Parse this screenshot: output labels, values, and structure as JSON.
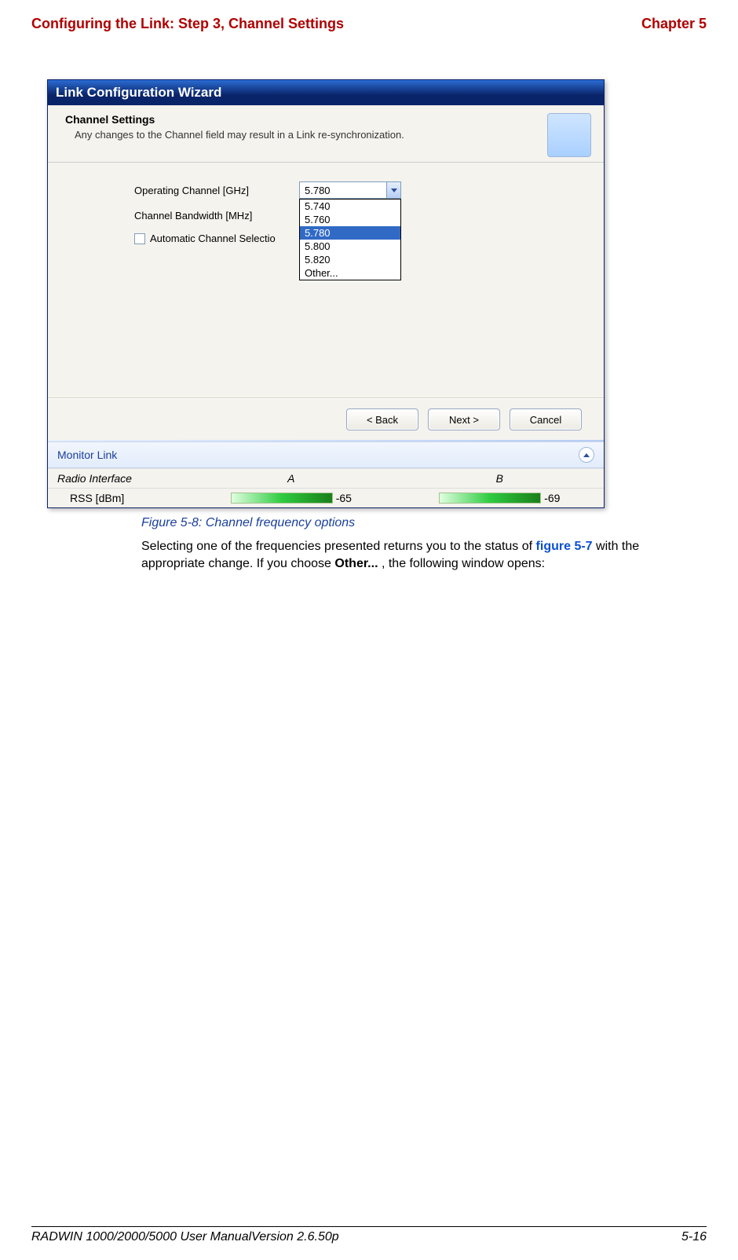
{
  "page": {
    "header_left": "Configuring the Link: Step 3, Channel Settings",
    "header_right": "Chapter 5",
    "footer_left": "RADWIN 1000/2000/5000 User ManualVersion  2.6.50p",
    "footer_right": "5-16"
  },
  "window": {
    "title": "Link Configuration Wizard",
    "heading": "Channel Settings",
    "subheading": "Any changes to the Channel field may result in a Link re-synchronization.",
    "labels": {
      "operating_channel": "Operating Channel [GHz]",
      "channel_bandwidth": "Channel Bandwidth [MHz]",
      "auto_channel": "Automatic Channel Selectio"
    },
    "operating_channel_value": "5.780",
    "dropdown_options": [
      "5.740",
      "5.760",
      "5.780",
      "5.800",
      "5.820",
      "Other..."
    ],
    "dropdown_selected_index": 2,
    "buttons": {
      "back": "< Back",
      "next": "Next >",
      "cancel": "Cancel"
    },
    "monitor": {
      "title": "Monitor Link",
      "radio_interface_label": "Radio Interface",
      "col_a": "A",
      "col_b": "B",
      "rss_label": "RSS [dBm]",
      "rss_a": "-65",
      "rss_b": "-69"
    }
  },
  "caption": "Figure 5-8: Channel frequency options",
  "paragraph": {
    "part1": "Selecting one of the frequencies presented returns you to the status of ",
    "link": "figure 5-7",
    "part2": " with the appropriate change. If you choose ",
    "bold": "Other...",
    "part3": ", the following window opens:"
  }
}
